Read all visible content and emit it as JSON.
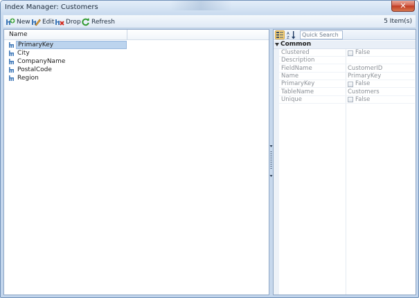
{
  "window": {
    "title": "Index Manager: Customers",
    "close_glyph": "✕"
  },
  "toolbar": {
    "new_label": "New",
    "edit_label": "Edit",
    "drop_label": "Drop",
    "refresh_label": "Refresh",
    "item_count": "5 Item(s)"
  },
  "list": {
    "column_header": "Name",
    "rows": [
      {
        "label": "PrimaryKey",
        "selected": true
      },
      {
        "label": "City",
        "selected": false
      },
      {
        "label": "CompanyName",
        "selected": false
      },
      {
        "label": "PostalCode",
        "selected": false
      },
      {
        "label": "Region",
        "selected": false
      }
    ]
  },
  "property_grid": {
    "search_placeholder": "Quick Search",
    "category": "Common",
    "properties": [
      {
        "name": "Clustered",
        "value": "False",
        "checkbox": true
      },
      {
        "name": "Description",
        "value": "",
        "checkbox": false
      },
      {
        "name": "FieldName",
        "value": "CustomerID",
        "checkbox": false
      },
      {
        "name": "Name",
        "value": "PrimaryKey",
        "checkbox": false
      },
      {
        "name": "PrimaryKey",
        "value": "False",
        "checkbox": true
      },
      {
        "name": "TableName",
        "value": "Customers",
        "checkbox": false
      },
      {
        "name": "Unique",
        "value": "False",
        "checkbox": true
      }
    ]
  },
  "icons": {
    "new": "add-index-icon",
    "edit": "edit-index-icon",
    "drop": "drop-index-icon",
    "refresh": "refresh-icon",
    "row": "index-icon",
    "categorized": "categorized-view-icon",
    "alphabetical": "alphabetical-sort-icon"
  },
  "colors": {
    "selection": "#bcd4ee",
    "window_chrome": "#c7d9ee",
    "close_button": "#c03b22"
  }
}
